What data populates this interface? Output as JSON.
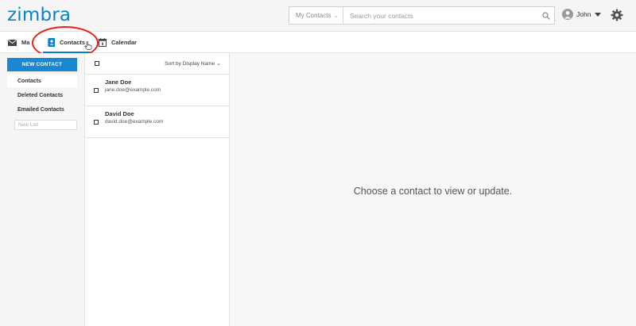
{
  "app": {
    "logo": "zimbra"
  },
  "search": {
    "scope": "My Contacts",
    "placeholder": "Search your contacts",
    "value": ""
  },
  "user": {
    "name": "John"
  },
  "tabs": [
    {
      "label": "Mail",
      "visible_label": "Ma"
    },
    {
      "label": "Contacts",
      "active": true
    },
    {
      "label": "Calendar"
    }
  ],
  "sidebar": {
    "new_contact_label": "NEW CONTACT",
    "folders": [
      {
        "label": "Contacts",
        "active": true
      },
      {
        "label": "Deleted Contacts"
      },
      {
        "label": "Emailed Contacts"
      }
    ],
    "new_list_placeholder": "New List"
  },
  "list": {
    "sort_label": "Sort by Display Name",
    "contacts": [
      {
        "name": "Jane Doe",
        "email": "jane.doe@example.com"
      },
      {
        "name": "David Doe",
        "email": "david.doe@example.com"
      }
    ]
  },
  "detail": {
    "empty_message": "Choose a contact to view or update."
  },
  "colors": {
    "brand": "#0b82c6",
    "button": "#1a87d0",
    "highlight": "#e3251b"
  }
}
